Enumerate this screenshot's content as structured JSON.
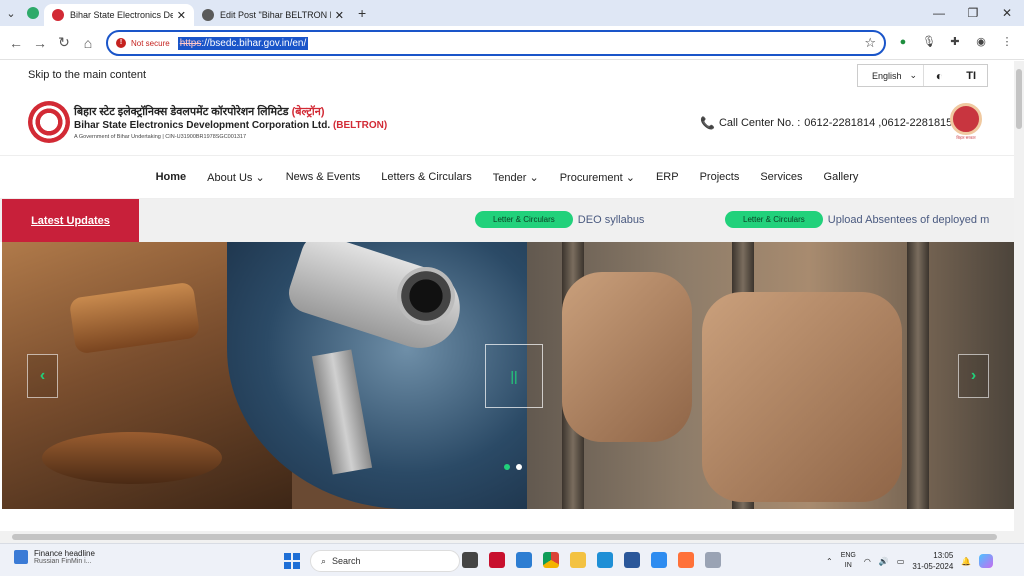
{
  "browser": {
    "tabs": [
      {
        "title": "Bihar State Electronics Develop",
        "active": true,
        "favicon_color": "#d22a35"
      },
      {
        "title": "Edit Post \"Bihar BELTRON DEO",
        "active": false,
        "favicon_color": "#5a5a5a"
      }
    ],
    "new_tab": "+",
    "omnibox": {
      "security_label": "Not secure",
      "url_scheme": "https",
      "url_rest": "://bsedc.bihar.gov.in/en/"
    }
  },
  "site": {
    "skip_link": "Skip to the main content",
    "language": "English",
    "brand_hindi": "बिहार स्टेट इलेक्ट्रॉनिक्स डेवलपमेंट कॉरपोरेशन लिमिटेड",
    "brand_hindi_tag": "(बेल्ट्रॉन)",
    "brand_english": "Bihar State Electronics Development Corporation Ltd.",
    "brand_english_tag": "(BELTRON)",
    "brand_sub": "A Government of Bihar Undertaking  |  CIN-U31900BR1978SGC001317",
    "call_center_label": "Call Center No. :",
    "call_center_numbers": "0612-2281814 ,0612-2281815",
    "emblem_caption": "बिहार सरकार",
    "nav": [
      {
        "label": "Home",
        "dropdown": false
      },
      {
        "label": "About Us",
        "dropdown": true
      },
      {
        "label": "News & Events",
        "dropdown": false
      },
      {
        "label": "Letters & Circulars",
        "dropdown": false
      },
      {
        "label": "Tender",
        "dropdown": true
      },
      {
        "label": "Procurement",
        "dropdown": true
      },
      {
        "label": "ERP",
        "dropdown": false
      },
      {
        "label": "Projects",
        "dropdown": false
      },
      {
        "label": "Services",
        "dropdown": false
      },
      {
        "label": "Gallery",
        "dropdown": false
      }
    ],
    "latest_updates_label": "Latest Updates",
    "ticker": [
      {
        "tag": "Letter & Circulars",
        "text": "DEO syllabus"
      },
      {
        "tag": "Letter & Circulars",
        "text": "Upload Absentees of deployed m"
      }
    ],
    "slider": {
      "prev": "‹",
      "next": "›",
      "pause": "||",
      "slides": 2,
      "active_slide": 1
    }
  },
  "taskbar": {
    "news_title": "Finance headline",
    "news_sub": "Russian FinMin i...",
    "search_placeholder": "Search",
    "lang_line1": "ENG",
    "lang_line2": "IN",
    "time": "13:05",
    "date": "31-05-2024"
  },
  "colors": {
    "brand_red": "#c8203a",
    "accent_green": "#21d17b",
    "omnibox_blue": "#1a55c9"
  }
}
